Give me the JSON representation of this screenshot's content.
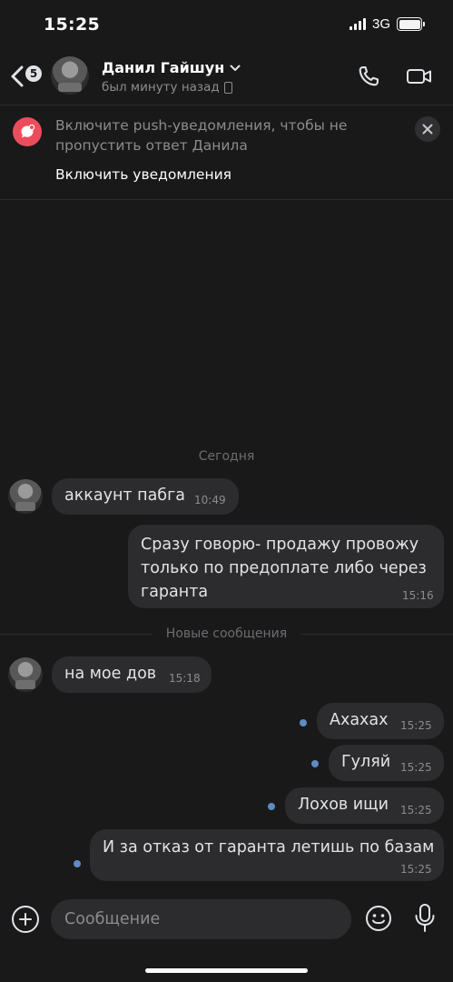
{
  "status_bar": {
    "time": "15:25",
    "network": "3G"
  },
  "header": {
    "unread_count": "5",
    "contact_name": "Данил Гайшун",
    "last_seen": "был минуту назад"
  },
  "push_banner": {
    "text": "Включите push-уведомления, чтобы не пропустить ответ Данила",
    "action": "Включить уведомления"
  },
  "chat": {
    "date_separator": "Сегодня",
    "new_messages_separator": "Новые сообщения",
    "messages": [
      {
        "direction": "incoming",
        "text": "аккаунт пабга",
        "time": "10:49"
      },
      {
        "direction": "outgoing",
        "text": "Сразу говорю- продажу провожу только по предоплате либо через гаранта",
        "time": "15:16"
      },
      {
        "direction": "incoming",
        "text": "на мое дов",
        "time": "15:18"
      },
      {
        "direction": "outgoing",
        "text": "Ахахах",
        "time": "15:25",
        "unread": true
      },
      {
        "direction": "outgoing",
        "text": "Гуляй",
        "time": "15:25",
        "unread": true
      },
      {
        "direction": "outgoing",
        "text": "Лохов ищи",
        "time": "15:25",
        "unread": true
      },
      {
        "direction": "outgoing",
        "text": "И за отказ от гаранта летишь по базам",
        "time": "15:25",
        "unread": true
      }
    ]
  },
  "composer": {
    "placeholder": "Сообщение"
  },
  "colors": {
    "background": "#19191a",
    "bubble": "#2c2c2e",
    "unread_dot": "#5f8ac2",
    "push_icon": "#ec4d5c"
  }
}
